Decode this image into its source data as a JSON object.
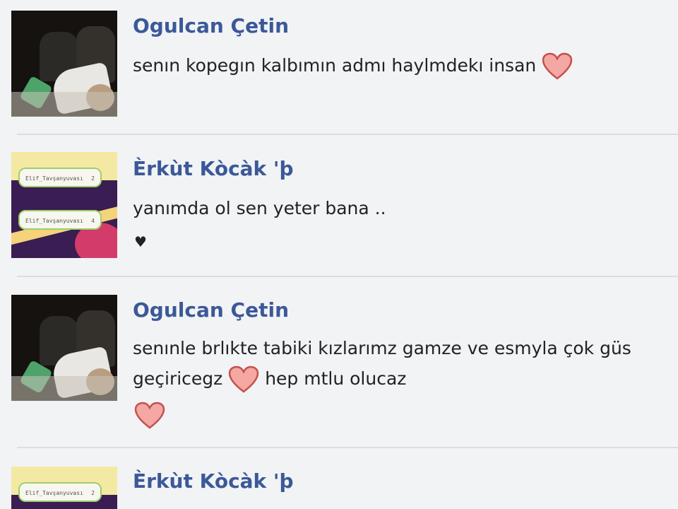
{
  "comments": [
    {
      "author": "Ogulcan Çetin",
      "lines": [
        "senın kopegın kalbımın admı haylmdekı insan"
      ]
    },
    {
      "author": "Èrkùt Kòcàk 'þ",
      "lines": [
        "yanımda ol sen yeter bana .."
      ],
      "avatar_bubbles": [
        "Elif_Tavşanyuvası",
        "Elif_Tavşanyuvası"
      ],
      "avatar_counts": [
        "2",
        "4"
      ]
    },
    {
      "author": "Ogulcan Çetin",
      "lines": [
        "senınle brlıkte tabiki kızlarımz gamze ve esmyla çok güs",
        "geçiricegz",
        "hep mtlu olucaz"
      ]
    },
    {
      "author": "Èrkùt Kòcàk 'þ"
    }
  ],
  "icons": {
    "heart": "heart-icon",
    "small_heart_glyph": "♥"
  },
  "colors": {
    "author_name": "#3b5998",
    "heart_fill": "#f4a7a3",
    "heart_stroke": "#c5504e"
  }
}
